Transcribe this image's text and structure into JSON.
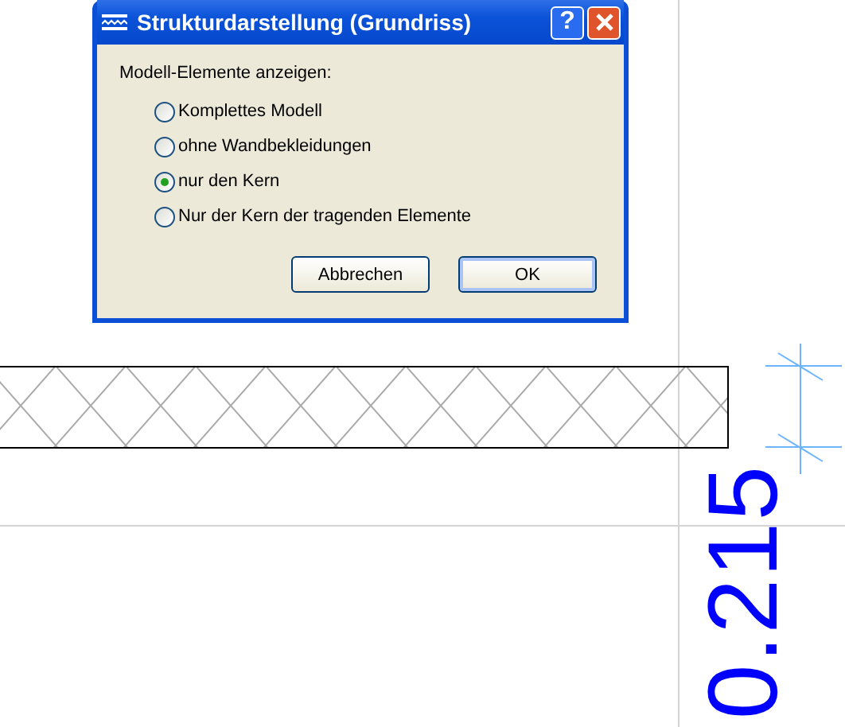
{
  "dialog": {
    "title": "Strukturdarstellung (Grundriss)",
    "help_button": "?",
    "group_label": "Modell-Elemente anzeigen:",
    "options": [
      {
        "label": "Komplettes Modell",
        "selected": false
      },
      {
        "label": "ohne Wandbekleidungen",
        "selected": false
      },
      {
        "label": "nur den Kern",
        "selected": true
      },
      {
        "label": "Nur der Kern der tragenden Elemente",
        "selected": false
      }
    ],
    "buttons": [
      {
        "label": "Abbrechen",
        "default": false
      },
      {
        "label": "OK",
        "default": true
      }
    ]
  },
  "canvas": {
    "dimension_text": "0.215"
  }
}
